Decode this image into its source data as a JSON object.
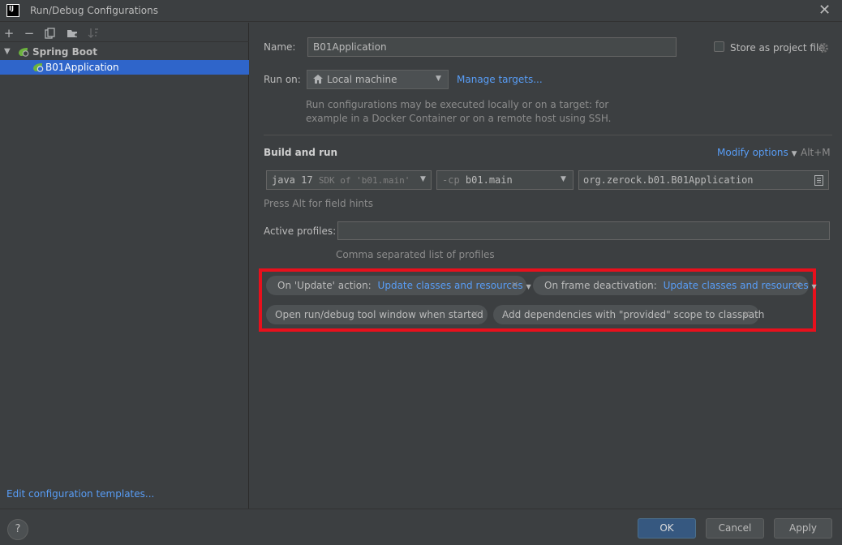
{
  "window": {
    "title": "Run/Debug Configurations",
    "app_icon_text": "IJ",
    "close_glyph": "✕"
  },
  "toolbar": {
    "add": "+",
    "remove": "−",
    "copy": "⧉",
    "folder": "▣",
    "sort": "↓"
  },
  "tree": {
    "group_label": "Spring Boot",
    "item_label": "B01Application"
  },
  "left": {
    "edit_templates": "Edit configuration templates..."
  },
  "form": {
    "name_label": "Name:",
    "name_value": "B01Application",
    "store_label": "Store as project file",
    "run_on_label": "Run on:",
    "run_on_value": "Local machine",
    "manage_targets": "Manage targets...",
    "run_hint_1": "Run configurations may be executed locally or on a target: for",
    "run_hint_2": "example in a Docker Container or on a remote host using SSH.",
    "build_run_title": "Build and run",
    "modify_options": "Modify options",
    "modify_shortcut": "Alt+M",
    "sdk_value": "java 17",
    "sdk_detail": "SDK of 'b01.main'",
    "cp_prefix": "-cp",
    "cp_value": "b01.main",
    "main_class": "org.zerock.b01.B01Application",
    "field_hint": "Press Alt for field hints",
    "profiles_label": "Active profiles:",
    "profiles_value": "",
    "profiles_hint": "Comma separated list of profiles"
  },
  "chips": {
    "update_label": "On 'Update' action:",
    "update_value": "Update classes and resources",
    "frame_label": "On frame deactivation:",
    "frame_value": "Update classes and resources",
    "open_tool": "Open run/debug tool window when started",
    "add_deps": "Add dependencies with \"provided\" scope to classpath"
  },
  "buttons": {
    "help": "?",
    "ok": "OK",
    "cancel": "Cancel",
    "apply": "Apply"
  },
  "colors": {
    "accent": "#589df6",
    "selection": "#2f65ca",
    "highlight_box": "#e8101c",
    "ok_button": "#365880"
  }
}
